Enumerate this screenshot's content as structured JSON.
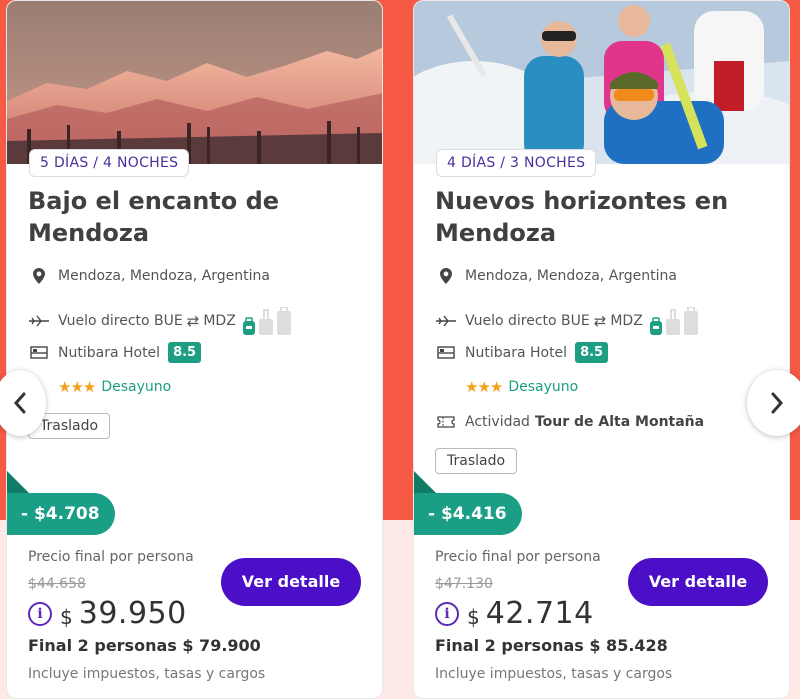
{
  "colors": {
    "brand_purple": "#4b0fc8",
    "discount_green": "#1a9e86",
    "score_green": "#1d9e82",
    "star_orange": "#f3a21c",
    "bg_red": "#f65a45"
  },
  "cards": [
    {
      "nights": "5 DÍAS / 4 NOCHES",
      "title": "Bajo el encanto de Mendoza",
      "location": "Mendoza, Mendoza, Argentina",
      "flight": "Vuelo directo BUE",
      "flight_dest": "MDZ",
      "hotel": "Nutibara Hotel",
      "score": "8.5",
      "stars": "★★★",
      "meal": "Desayuno",
      "activity_label": "",
      "activity_name": "",
      "transfer": "Traslado",
      "discount": "- $4.708",
      "precio_label": "Precio final por persona",
      "old_price": "$44.658",
      "currency": "$",
      "price": "39.950",
      "final_persons": "Final 2 personas $ 79.900",
      "incluye": "Incluye impuestos, tasas y cargos",
      "button": "Ver detalle"
    },
    {
      "nights": "4 DÍAS / 3 NOCHES",
      "title": "Nuevos horizontes en Mendoza",
      "location": "Mendoza, Mendoza, Argentina",
      "flight": "Vuelo directo BUE",
      "flight_dest": "MDZ",
      "hotel": "Nutibara Hotel",
      "score": "8.5",
      "stars": "★★★",
      "meal": "Desayuno",
      "activity_label": "Actividad",
      "activity_name": "Tour de Alta Montaña",
      "transfer": "Traslado",
      "discount": "- $4.416",
      "precio_label": "Precio final por persona",
      "old_price": "$47.130",
      "currency": "$",
      "price": "42.714",
      "final_persons": "Final 2 personas $ 85.428",
      "incluye": "Incluye impuestos, tasas y cargos",
      "button": "Ver detalle"
    }
  ],
  "icons": {
    "prev": "chevron-left-icon",
    "next": "chevron-right-icon",
    "location": "map-pin-icon",
    "flight": "plane-icon",
    "hotel": "bed-icon",
    "activity": "ticket-icon",
    "info": "info-icon"
  }
}
